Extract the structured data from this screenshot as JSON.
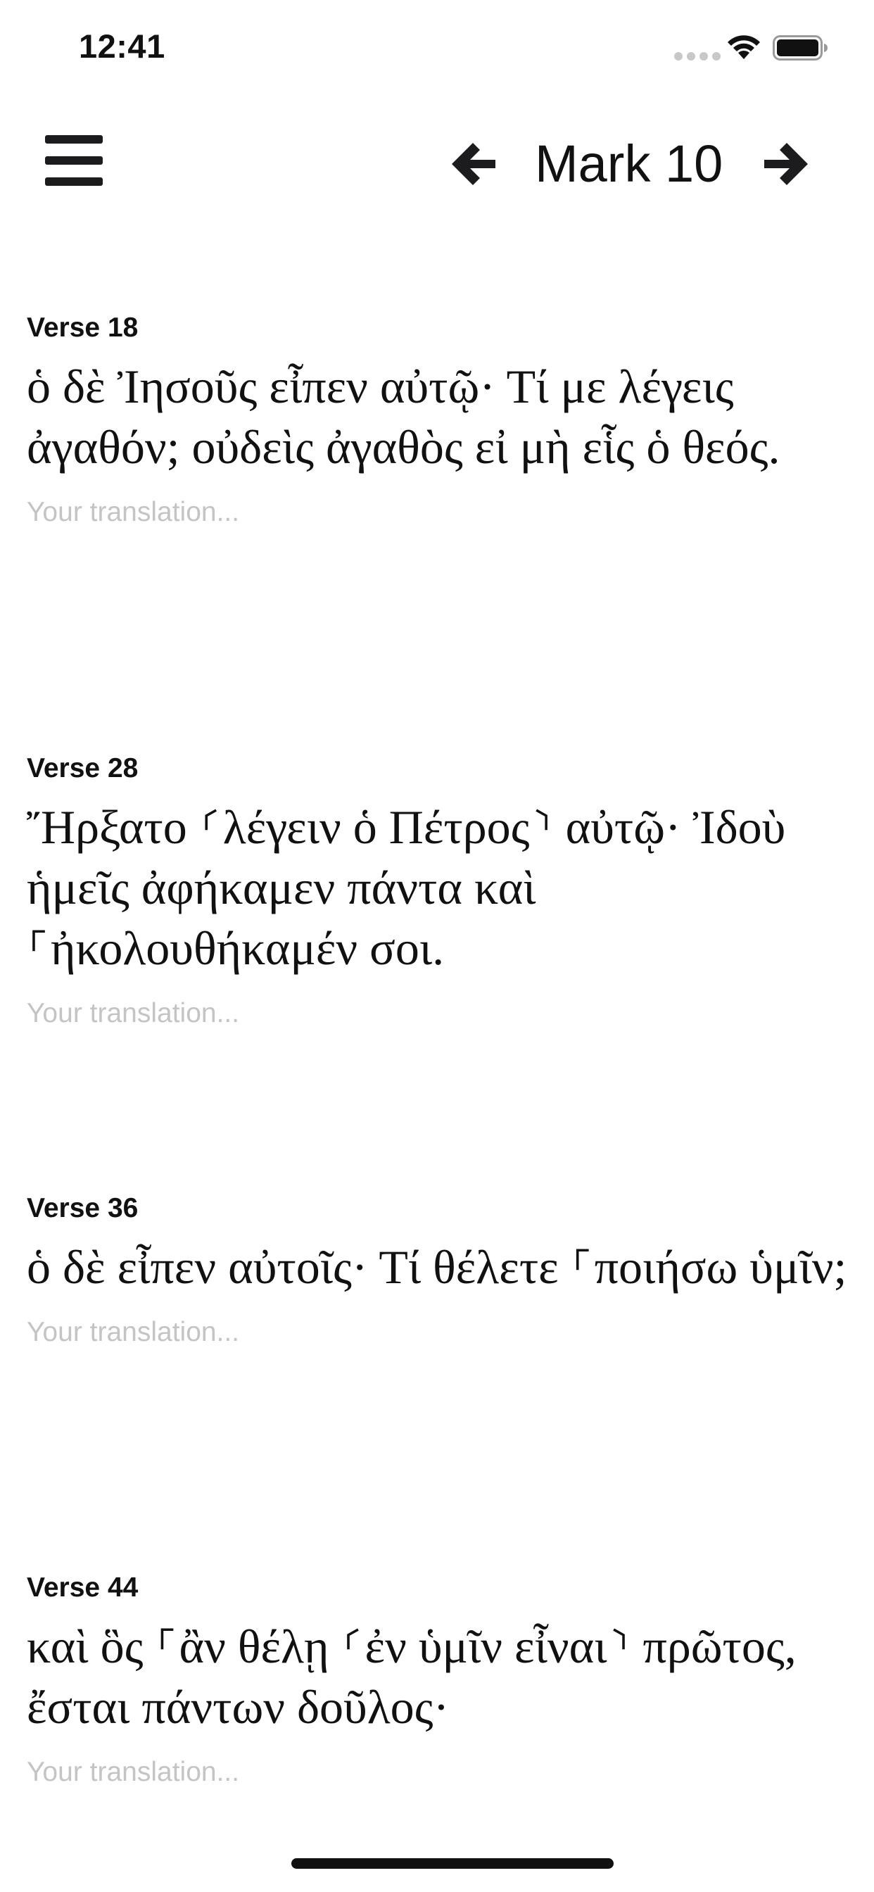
{
  "status_bar": {
    "time": "12:41",
    "icons": [
      "signal-icon",
      "wifi-icon",
      "battery-icon"
    ]
  },
  "nav": {
    "menu_icon": "hamburger-menu-icon",
    "prev_icon": "arrow-left-icon",
    "next_icon": "arrow-right-icon",
    "chapter_title": "Mark 10"
  },
  "verses": [
    {
      "label": "Verse 18",
      "text": "ὁ δὲ Ἰησοῦς εἶπεν αὐτῷ· Τί με λέγεις ἀγαθόν; οὐδεὶς ἀγαθὸς εἰ μὴ εἷς ὁ θεός.",
      "placeholder": "Your translation..."
    },
    {
      "label": "Verse 28",
      "text": "Ἤρξατο ⸂λέγειν ὁ Πέτρος⸃ αὐτῷ· Ἰδοὺ ἡμεῖς ἀφήκαμεν πάντα καὶ ⸀ἠκολουθήκαμέν σοι.",
      "placeholder": "Your translation..."
    },
    {
      "label": "Verse 36",
      "text": "ὁ δὲ εἶπεν αὐτοῖς· Τί θέλετε ⸀ποιήσω ὑμῖν;",
      "placeholder": "Your translation..."
    },
    {
      "label": "Verse 44",
      "text": "καὶ ὃς ⸀ἂν θέλῃ ⸂ἐν ὑμῖν εἶναι⸃ πρῶτος, ἔσται πάντων δοῦλος·",
      "placeholder": "Your translation..."
    }
  ]
}
